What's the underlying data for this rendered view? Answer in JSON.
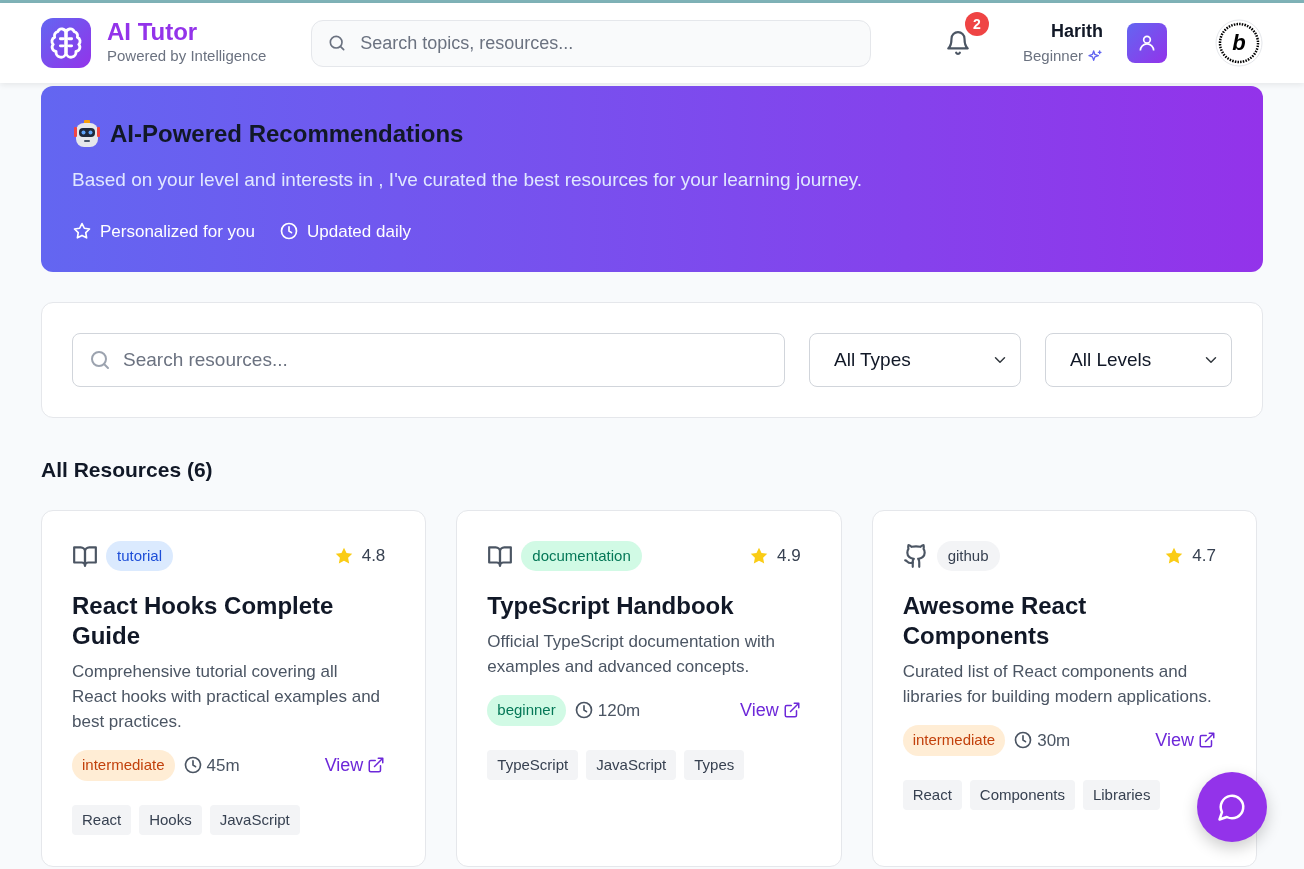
{
  "header": {
    "app_name": "AI Tutor",
    "tagline": "Powered by Intelligence",
    "search": {
      "placeholder": "Search topics, resources..."
    },
    "notifications": "2",
    "user": {
      "name": "Harith",
      "level": "Beginner"
    },
    "badge": {
      "letter": "b"
    }
  },
  "banner": {
    "title": "AI-Powered Recommendations",
    "text": "Based on your level and interests in , I've curated the best resources for your learning journey.",
    "features": [
      {
        "kind": "star",
        "label": "Personalized for you"
      },
      {
        "kind": "clock",
        "label": "Updated daily"
      }
    ]
  },
  "filters": {
    "search": {
      "placeholder": "Search resources..."
    },
    "type": "All Types",
    "level": "All Levels"
  },
  "section_title": "All Resources (6)",
  "resources": [
    {
      "kind": "book",
      "type": "tutorial",
      "rating": "4.8",
      "title": "React Hooks Complete Guide",
      "description": "Comprehensive tutorial covering all React hooks with practical examples and best practices.",
      "level": "intermediate",
      "duration": "45m",
      "link": "View",
      "tags": [
        "React",
        "Hooks",
        "JavaScript"
      ]
    },
    {
      "kind": "book",
      "type": "documentation",
      "rating": "4.9",
      "title": "TypeScript Handbook",
      "description": "Official TypeScript documentation with examples and advanced concepts.",
      "level": "beginner",
      "duration": "120m",
      "link": "View",
      "tags": [
        "TypeScript",
        "JavaScript",
        "Types"
      ]
    },
    {
      "kind": "repo",
      "type": "github",
      "rating": "4.7",
      "title": "Awesome React Components",
      "description": "Curated list of React components and libraries for building modern applications.",
      "level": "intermediate",
      "duration": "30m",
      "link": "View",
      "tags": [
        "React",
        "Components",
        "Libraries"
      ]
    }
  ]
}
